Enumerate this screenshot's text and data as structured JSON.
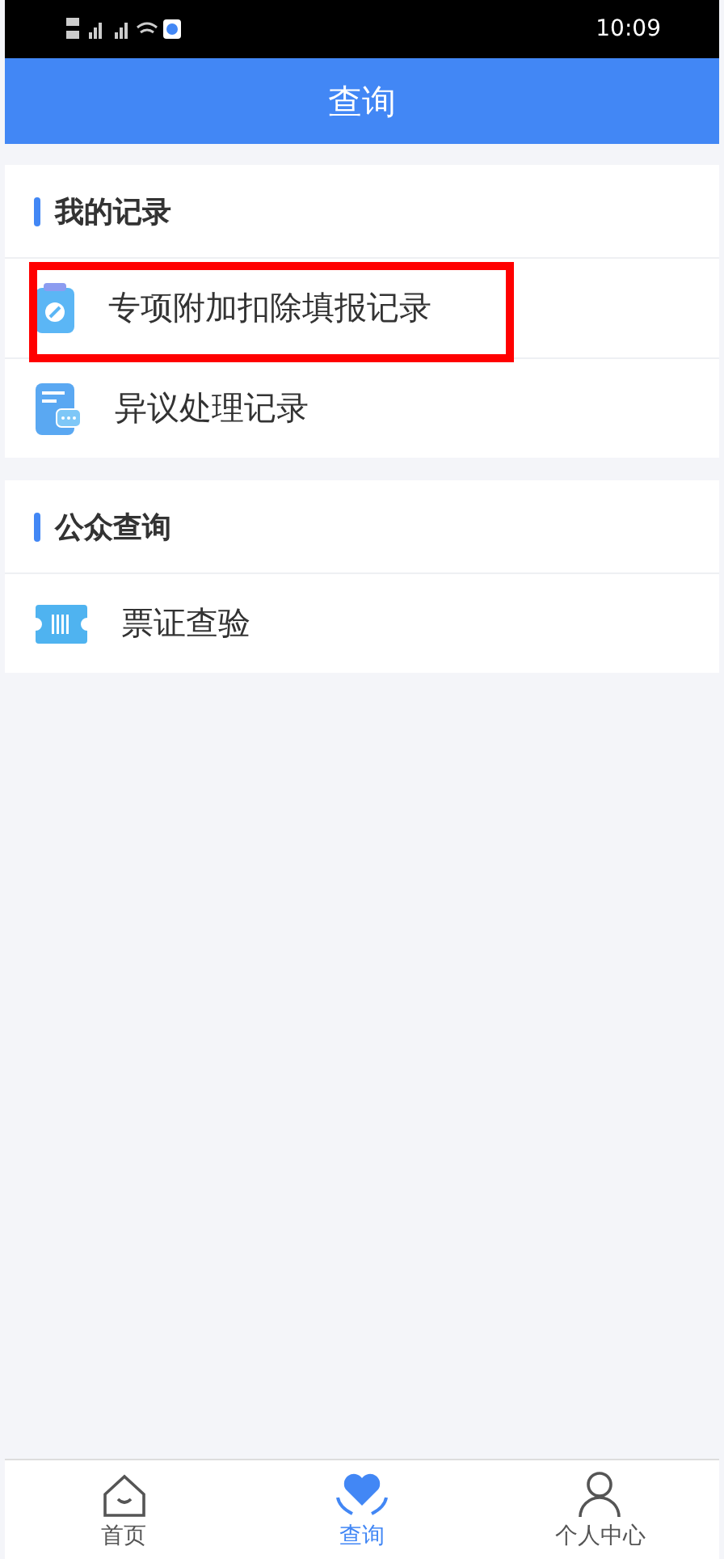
{
  "status_bar": {
    "time": "10:09"
  },
  "header": {
    "title": "查询"
  },
  "sections": [
    {
      "title": "我的记录",
      "items": [
        {
          "label": "专项附加扣除填报记录",
          "kind": "clipboard",
          "highlighted": true
        },
        {
          "label": "异议处理记录",
          "kind": "document",
          "highlighted": false
        }
      ]
    },
    {
      "title": "公众查询",
      "items": [
        {
          "label": "票证查验",
          "kind": "ticket",
          "highlighted": false
        }
      ]
    }
  ],
  "tab_bar": [
    {
      "label": "首页",
      "kind": "home",
      "selected": false
    },
    {
      "label": "查询",
      "kind": "heart",
      "selected": true
    },
    {
      "label": "个人中心",
      "kind": "person",
      "selected": false
    }
  ]
}
